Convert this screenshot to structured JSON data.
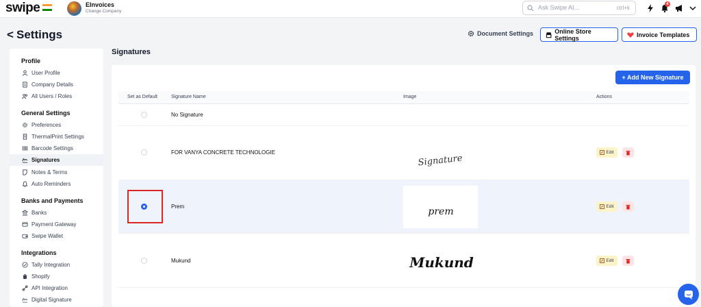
{
  "topbar": {
    "logo": "swipe",
    "company_name": "EInvoices",
    "company_subtitle": "Change Company",
    "search_placeholder": "Ask Swipe AI...",
    "search_shortcut": "ctrl+k",
    "notification_count": "4"
  },
  "header": {
    "back_glyph": "<",
    "title": "Settings",
    "document_settings": "Document Settings",
    "online_store_settings": "Online Store Settings",
    "invoice_templates": "Invoice Templates"
  },
  "sidebar": {
    "sections": [
      {
        "title": "Profile",
        "items": [
          "User Profile",
          "Company Details",
          "All Users / Roles"
        ]
      },
      {
        "title": "General Settings",
        "items": [
          "Preferences",
          "ThermalPrint Settings",
          "Barcode Settings",
          "Signatures",
          "Notes & Terms",
          "Auto Reminders"
        ]
      },
      {
        "title": "Banks and Payments",
        "items": [
          "Banks",
          "Payment Gateway",
          "Swipe Wallet"
        ]
      },
      {
        "title": "Integrations",
        "items": [
          "Tally Integration",
          "Shopify",
          "API Integration",
          "Digital Signature"
        ]
      }
    ],
    "active_item": "Signatures"
  },
  "main": {
    "title": "Signatures",
    "add_button": "+ Add New Signature",
    "columns": [
      "Set as Default",
      "Signature Name",
      "Image",
      "Actions"
    ],
    "rows": [
      {
        "name": "No Signature",
        "image_text": "",
        "default": false,
        "actions": false
      },
      {
        "name": "FOR VANYA CONCRETE TECHNOLOGIE",
        "image_text": "Signature",
        "default": false,
        "actions": true
      },
      {
        "name": "Prem",
        "image_text": "prem",
        "default": true,
        "actions": true
      },
      {
        "name": "Mukund",
        "image_text": "Mukund",
        "default": false,
        "actions": true
      }
    ],
    "edit_label": "Edit"
  },
  "colors": {
    "primary": "#2563eb",
    "highlight": "#dc2626",
    "selected_row": "#eef3fc",
    "edit_bg": "#fdf3c8",
    "delete_bg": "#fde5e5"
  },
  "icons": [
    "search-icon",
    "bolt-icon",
    "bell-icon",
    "megaphone-icon",
    "gear-icon",
    "store-icon",
    "heart-icon",
    "edit-icon",
    "trash-icon",
    "chat-icon"
  ]
}
